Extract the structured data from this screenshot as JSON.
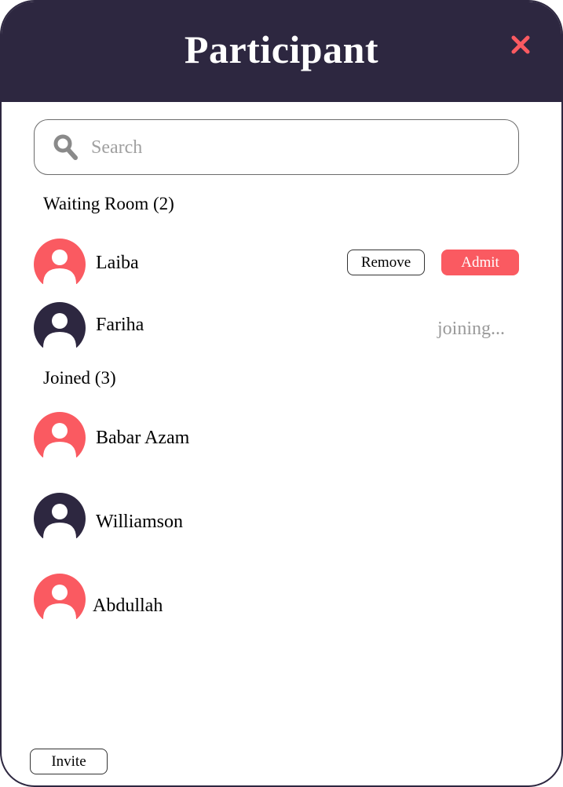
{
  "header": {
    "title": "Participant",
    "close_icon": "close-icon"
  },
  "search": {
    "placeholder": "Search",
    "value": "",
    "icon": "search-icon"
  },
  "waiting_room": {
    "label": "Waiting Room (2)",
    "participants": [
      {
        "name": "Laiba",
        "avatar_color": "#fa5a61",
        "remove_label": "Remove",
        "admit_label": "Admit"
      },
      {
        "name": "Fariha",
        "avatar_color": "#2d2740",
        "status": "joining..."
      }
    ]
  },
  "joined": {
    "label": "Joined (3)",
    "participants": [
      {
        "name": "Babar Azam",
        "avatar_color": "#fa5a61"
      },
      {
        "name": "Williamson",
        "avatar_color": "#2d2740"
      },
      {
        "name": "Abdullah",
        "avatar_color": "#fa5a61"
      }
    ]
  },
  "footer": {
    "invite_label": "Invite"
  },
  "colors": {
    "header_bg": "#2d2740",
    "accent": "#fa5a61",
    "dark_avatar": "#2d2740",
    "muted_text": "#9a9a9a"
  }
}
